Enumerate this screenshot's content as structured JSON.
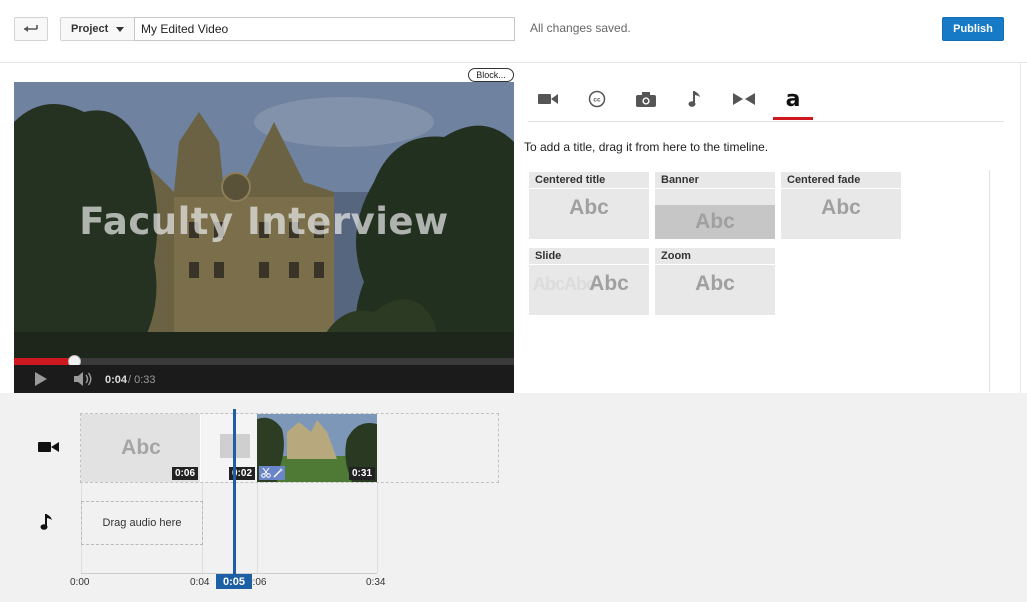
{
  "header": {
    "project_label": "Project",
    "title_value": "My Edited Video",
    "status": "All changes saved.",
    "publish_label": "Publish"
  },
  "preview": {
    "badge": "Block...",
    "overlay_title": "Faculty Interview",
    "time_current": "0:04",
    "time_total": "/ 0:33",
    "progress_fraction": 0.12
  },
  "tabs": [
    {
      "icon": "video-camera-icon"
    },
    {
      "icon": "closed-captions-icon"
    },
    {
      "icon": "photo-camera-icon"
    },
    {
      "icon": "music-note-icon"
    },
    {
      "icon": "transitions-icon"
    },
    {
      "icon": "text-title-icon",
      "selected": true
    }
  ],
  "titles_panel": {
    "hint": "To add a title, drag it from here to the timeline.",
    "cards": [
      {
        "label": "Centered title",
        "preview": "Abc"
      },
      {
        "label": "Banner",
        "preview": "Abc"
      },
      {
        "label": "Centered fade",
        "preview": "Abc"
      },
      {
        "label": "Slide",
        "preview": "Abc"
      },
      {
        "label": "Zoom",
        "preview": "Abc"
      }
    ]
  },
  "timeline": {
    "clips": [
      {
        "preview": "Abc",
        "duration": "0:06"
      },
      {
        "duration": "0:02"
      },
      {
        "duration": "0:31"
      }
    ],
    "audio_placeholder": "Drag audio here",
    "ticks": [
      "0:00",
      "0:04",
      "0:06",
      "0:34"
    ],
    "playhead_time": "0:05"
  },
  "colors": {
    "accent": "#167ac6",
    "progress": "#cc181e",
    "playhead": "#1c5fa5"
  }
}
